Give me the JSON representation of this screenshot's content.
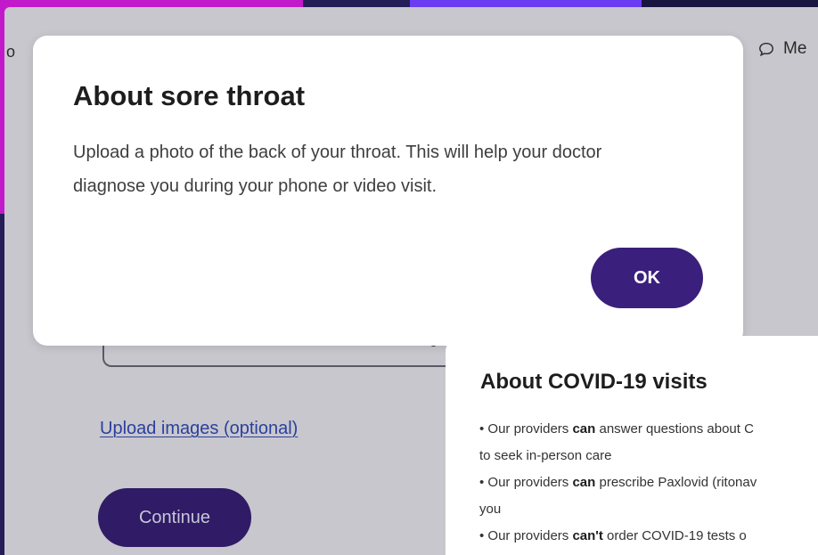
{
  "background_page": {
    "topbar_left_fragment": "o",
    "topbar_right_fragment": "Me",
    "upload_link": "Upload images (optional)",
    "continue_button": "Continue",
    "stray_fragment": "o"
  },
  "throat_modal": {
    "title": "About sore throat",
    "body": "Upload a photo of the back of your throat. This will help your doctor diagnose you during your phone or video visit.",
    "ok_button": "OK"
  },
  "covid_modal": {
    "title": "About COVID-19 visits",
    "lines": [
      {
        "pre": "• Our providers ",
        "bold": "can",
        "post": " answer questions about C"
      },
      {
        "pre": "to seek in-person care",
        "bold": "",
        "post": ""
      },
      {
        "pre": "• Our providers ",
        "bold": "can",
        "post": " prescribe Paxlovid (ritonav"
      },
      {
        "pre": "you",
        "bold": "",
        "post": ""
      },
      {
        "pre": "• Our providers ",
        "bold": "can't",
        "post": " order COVID-19 tests o"
      }
    ]
  },
  "colors": {
    "primary_button": "#3a1f7c",
    "link": "#2b3f9e",
    "overlay": "#c8c7cd"
  },
  "icons": {
    "chat": "chat-bubble-icon"
  }
}
